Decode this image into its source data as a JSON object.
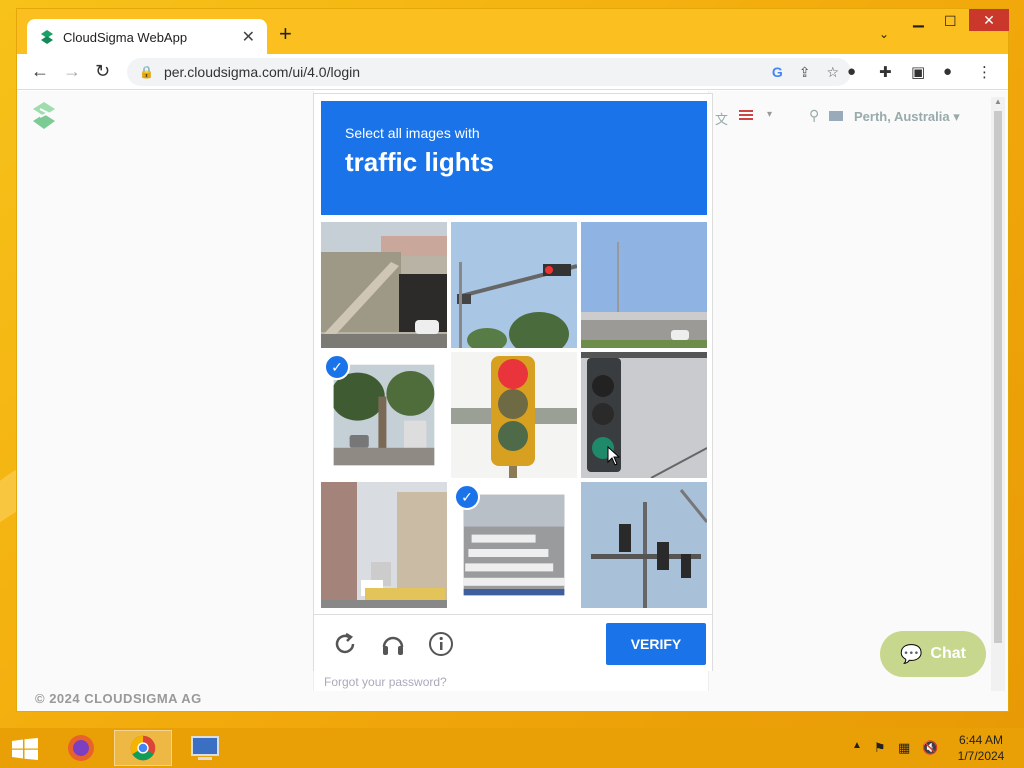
{
  "browser": {
    "tab_title": "CloudSigma WebApp",
    "new_tab": "+",
    "url": "per.cloudsigma.com/ui/4.0/login"
  },
  "page": {
    "location": "Perth, Australia",
    "forgot_password": "Forgot your password?",
    "footer": "© 2024 CLOUDSIGMA AG",
    "chat_label": "Chat"
  },
  "captcha": {
    "instruction": "Select all images with",
    "object": "traffic lights",
    "verify_label": "VERIFY",
    "tiles": [
      {
        "scene": "stairs-underpass",
        "selected": false
      },
      {
        "scene": "traffic-light-on-pole",
        "selected": false
      },
      {
        "scene": "highway-overpass",
        "selected": false
      },
      {
        "scene": "street-with-trees",
        "selected": true
      },
      {
        "scene": "traffic-light-closeup",
        "selected": false
      },
      {
        "scene": "traffic-light-side",
        "selected": false
      },
      {
        "scene": "city-street-buildings",
        "selected": false
      },
      {
        "scene": "crosswalk",
        "selected": true
      },
      {
        "scene": "traffic-lights-overhead",
        "selected": false
      }
    ]
  },
  "taskbar": {
    "time": "6:44 AM",
    "date": "1/7/2024"
  },
  "colors": {
    "accent": "#1a73e8",
    "titlebar": "#fbc01f",
    "taskbar": "#e9a007",
    "chat": "#c7d78e"
  }
}
